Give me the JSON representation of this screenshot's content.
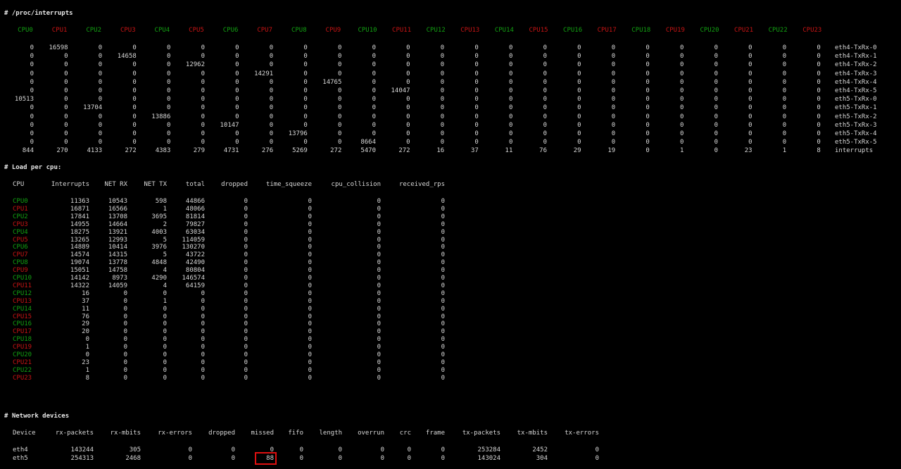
{
  "colors": {
    "green": "#12a012",
    "red": "#c81414",
    "text": "#d8d8d8",
    "background": "#000000",
    "highlight": "#e01010"
  },
  "interrupts": {
    "header": "# /proc/interrupts",
    "cpus": [
      "CPU0",
      "CPU1",
      "CPU2",
      "CPU3",
      "CPU4",
      "CPU5",
      "CPU6",
      "CPU7",
      "CPU8",
      "CPU9",
      "CPU10",
      "CPU11",
      "CPU12",
      "CPU13",
      "CPU14",
      "CPU15",
      "CPU16",
      "CPU17",
      "CPU18",
      "CPU19",
      "CPU20",
      "CPU21",
      "CPU22",
      "CPU23"
    ],
    "rows": [
      {
        "values": [
          "0",
          "16598",
          "0",
          "0",
          "0",
          "0",
          "0",
          "0",
          "0",
          "0",
          "0",
          "0",
          "0",
          "0",
          "0",
          "0",
          "0",
          "0",
          "0",
          "0",
          "0",
          "0",
          "0",
          "0"
        ],
        "name": "eth4-TxRx-0"
      },
      {
        "values": [
          "0",
          "0",
          "0",
          "14658",
          "0",
          "0",
          "0",
          "0",
          "0",
          "0",
          "0",
          "0",
          "0",
          "0",
          "0",
          "0",
          "0",
          "0",
          "0",
          "0",
          "0",
          "0",
          "0",
          "0"
        ],
        "name": "eth4-TxRx-1"
      },
      {
        "values": [
          "0",
          "0",
          "0",
          "0",
          "0",
          "12962",
          "0",
          "0",
          "0",
          "0",
          "0",
          "0",
          "0",
          "0",
          "0",
          "0",
          "0",
          "0",
          "0",
          "0",
          "0",
          "0",
          "0",
          "0"
        ],
        "name": "eth4-TxRx-2"
      },
      {
        "values": [
          "0",
          "0",
          "0",
          "0",
          "0",
          "0",
          "0",
          "14291",
          "0",
          "0",
          "0",
          "0",
          "0",
          "0",
          "0",
          "0",
          "0",
          "0",
          "0",
          "0",
          "0",
          "0",
          "0",
          "0"
        ],
        "name": "eth4-TxRx-3"
      },
      {
        "values": [
          "0",
          "0",
          "0",
          "0",
          "0",
          "0",
          "0",
          "0",
          "0",
          "14765",
          "0",
          "0",
          "0",
          "0",
          "0",
          "0",
          "0",
          "0",
          "0",
          "0",
          "0",
          "0",
          "0",
          "0"
        ],
        "name": "eth4-TxRx-4"
      },
      {
        "values": [
          "0",
          "0",
          "0",
          "0",
          "0",
          "0",
          "0",
          "0",
          "0",
          "0",
          "0",
          "14047",
          "0",
          "0",
          "0",
          "0",
          "0",
          "0",
          "0",
          "0",
          "0",
          "0",
          "0",
          "0"
        ],
        "name": "eth4-TxRx-5"
      },
      {
        "values": [
          "10513",
          "0",
          "0",
          "0",
          "0",
          "0",
          "0",
          "0",
          "0",
          "0",
          "0",
          "0",
          "0",
          "0",
          "0",
          "0",
          "0",
          "0",
          "0",
          "0",
          "0",
          "0",
          "0",
          "0"
        ],
        "name": "eth5-TxRx-0"
      },
      {
        "values": [
          "0",
          "0",
          "13704",
          "0",
          "0",
          "0",
          "0",
          "0",
          "0",
          "0",
          "0",
          "0",
          "0",
          "0",
          "0",
          "0",
          "0",
          "0",
          "0",
          "0",
          "0",
          "0",
          "0",
          "0"
        ],
        "name": "eth5-TxRx-1"
      },
      {
        "values": [
          "0",
          "0",
          "0",
          "0",
          "13886",
          "0",
          "0",
          "0",
          "0",
          "0",
          "0",
          "0",
          "0",
          "0",
          "0",
          "0",
          "0",
          "0",
          "0",
          "0",
          "0",
          "0",
          "0",
          "0"
        ],
        "name": "eth5-TxRx-2"
      },
      {
        "values": [
          "0",
          "0",
          "0",
          "0",
          "0",
          "0",
          "10147",
          "0",
          "0",
          "0",
          "0",
          "0",
          "0",
          "0",
          "0",
          "0",
          "0",
          "0",
          "0",
          "0",
          "0",
          "0",
          "0",
          "0"
        ],
        "name": "eth5-TxRx-3"
      },
      {
        "values": [
          "0",
          "0",
          "0",
          "0",
          "0",
          "0",
          "0",
          "0",
          "13796",
          "0",
          "0",
          "0",
          "0",
          "0",
          "0",
          "0",
          "0",
          "0",
          "0",
          "0",
          "0",
          "0",
          "0",
          "0"
        ],
        "name": "eth5-TxRx-4"
      },
      {
        "values": [
          "0",
          "0",
          "0",
          "0",
          "0",
          "0",
          "0",
          "0",
          "0",
          "0",
          "8664",
          "0",
          "0",
          "0",
          "0",
          "0",
          "0",
          "0",
          "0",
          "0",
          "0",
          "0",
          "0",
          "0"
        ],
        "name": "eth5-TxRx-5"
      },
      {
        "values": [
          "844",
          "270",
          "4133",
          "272",
          "4383",
          "279",
          "4731",
          "276",
          "5269",
          "272",
          "5470",
          "272",
          "16",
          "37",
          "11",
          "76",
          "29",
          "19",
          "0",
          "1",
          "0",
          "23",
          "1",
          "8"
        ],
        "name": "interrupts"
      }
    ]
  },
  "load": {
    "header": "# Load per cpu:",
    "columns": [
      "CPU",
      "Interrupts",
      "NET RX",
      "NET TX",
      "total",
      "dropped",
      "time_squeeze",
      "cpu_collision",
      "received_rps"
    ],
    "rows": [
      [
        "CPU0",
        "11363",
        "10543",
        "598",
        "44866",
        "0",
        "0",
        "0",
        "0"
      ],
      [
        "CPU1",
        "16871",
        "16566",
        "1",
        "48066",
        "0",
        "0",
        "0",
        "0"
      ],
      [
        "CPU2",
        "17841",
        "13708",
        "3695",
        "81814",
        "0",
        "0",
        "0",
        "0"
      ],
      [
        "CPU3",
        "14955",
        "14664",
        "2",
        "79827",
        "0",
        "0",
        "0",
        "0"
      ],
      [
        "CPU4",
        "18275",
        "13921",
        "4003",
        "63034",
        "0",
        "0",
        "0",
        "0"
      ],
      [
        "CPU5",
        "13265",
        "12993",
        "5",
        "114059",
        "0",
        "0",
        "0",
        "0"
      ],
      [
        "CPU6",
        "14889",
        "10414",
        "3976",
        "130270",
        "0",
        "0",
        "0",
        "0"
      ],
      [
        "CPU7",
        "14574",
        "14315",
        "5",
        "43722",
        "0",
        "0",
        "0",
        "0"
      ],
      [
        "CPU8",
        "19074",
        "13778",
        "4848",
        "42490",
        "0",
        "0",
        "0",
        "0"
      ],
      [
        "CPU9",
        "15051",
        "14758",
        "4",
        "80804",
        "0",
        "0",
        "0",
        "0"
      ],
      [
        "CPU10",
        "14142",
        "8973",
        "4290",
        "146574",
        "0",
        "0",
        "0",
        "0"
      ],
      [
        "CPU11",
        "14322",
        "14059",
        "4",
        "64159",
        "0",
        "0",
        "0",
        "0"
      ],
      [
        "CPU12",
        "16",
        "0",
        "0",
        "0",
        "0",
        "0",
        "0",
        "0"
      ],
      [
        "CPU13",
        "37",
        "0",
        "1",
        "0",
        "0",
        "0",
        "0",
        "0"
      ],
      [
        "CPU14",
        "11",
        "0",
        "0",
        "0",
        "0",
        "0",
        "0",
        "0"
      ],
      [
        "CPU15",
        "76",
        "0",
        "0",
        "0",
        "0",
        "0",
        "0",
        "0"
      ],
      [
        "CPU16",
        "29",
        "0",
        "0",
        "0",
        "0",
        "0",
        "0",
        "0"
      ],
      [
        "CPU17",
        "20",
        "0",
        "0",
        "0",
        "0",
        "0",
        "0",
        "0"
      ],
      [
        "CPU18",
        "0",
        "0",
        "0",
        "0",
        "0",
        "0",
        "0",
        "0"
      ],
      [
        "CPU19",
        "1",
        "0",
        "0",
        "0",
        "0",
        "0",
        "0",
        "0"
      ],
      [
        "CPU20",
        "0",
        "0",
        "0",
        "0",
        "0",
        "0",
        "0",
        "0"
      ],
      [
        "CPU21",
        "23",
        "0",
        "0",
        "0",
        "0",
        "0",
        "0",
        "0"
      ],
      [
        "CPU22",
        "1",
        "0",
        "0",
        "0",
        "0",
        "0",
        "0",
        "0"
      ],
      [
        "CPU23",
        "8",
        "0",
        "0",
        "0",
        "0",
        "0",
        "0",
        "0"
      ]
    ]
  },
  "network": {
    "header": "# Network devices",
    "columns": [
      "Device",
      "rx-packets",
      "rx-mbits",
      "rx-errors",
      "dropped",
      "missed",
      "fifo",
      "length",
      "overrun",
      "crc",
      "frame",
      "tx-packets",
      "tx-mbits",
      "tx-errors"
    ],
    "rows": [
      [
        "eth4",
        "143244",
        "305",
        "0",
        "0",
        "0",
        "0",
        "0",
        "0",
        "0",
        "0",
        "253284",
        "2452",
        "0"
      ],
      [
        "eth5",
        "254313",
        "2468",
        "0",
        "0",
        "88",
        "0",
        "0",
        "0",
        "0",
        "0",
        "143024",
        "304",
        "0"
      ]
    ],
    "highlighted_cell": {
      "row": 1,
      "column": "missed"
    }
  }
}
